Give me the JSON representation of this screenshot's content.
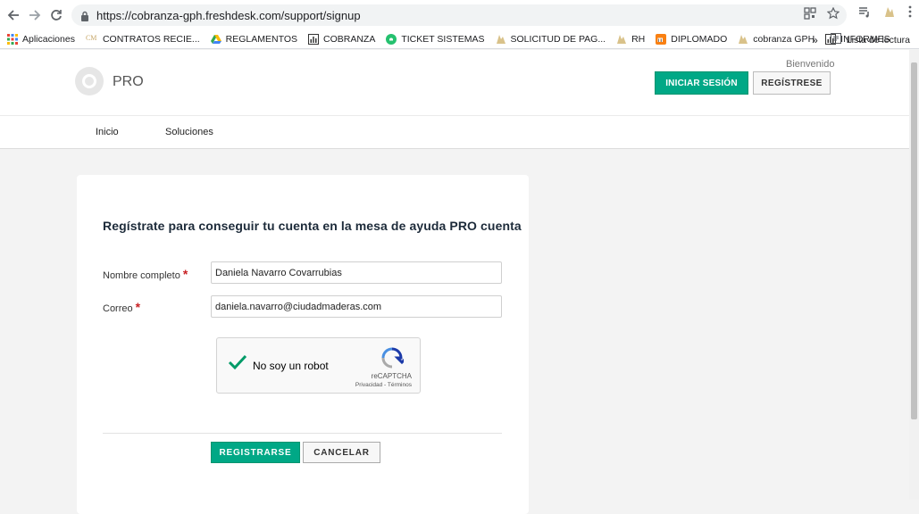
{
  "browser": {
    "url": "https://cobranza-gph.freshdesk.com/support/signup",
    "bookmarks": [
      {
        "label": "Aplicaciones",
        "icon": "apps-grid-icon"
      },
      {
        "label": "CONTRATOS RECIE...",
        "icon": "cm-icon"
      },
      {
        "label": "REGLAMENTOS",
        "icon": "drive-icon"
      },
      {
        "label": "COBRANZA",
        "icon": "chart-icon"
      },
      {
        "label": "TICKET SISTEMAS",
        "icon": "freshdesk-icon"
      },
      {
        "label": "SOLICITUD DE PAG...",
        "icon": "tree-icon"
      },
      {
        "label": "RH",
        "icon": "tree-icon"
      },
      {
        "label": "DIPLOMADO",
        "icon": "moodle-icon"
      },
      {
        "label": "cobranza GPH",
        "icon": "tree-icon"
      },
      {
        "label": "INFORMES",
        "icon": "chart-icon"
      }
    ],
    "more_label": "»",
    "reading_list_label": "Lista de lectura"
  },
  "header": {
    "brand": "PRO",
    "welcome": "Bienvenido",
    "login_label": "INICIAR SESIÓN",
    "register_label": "REGÍSTRESE"
  },
  "nav": {
    "items": [
      {
        "label": "Inicio"
      },
      {
        "label": "Soluciones"
      }
    ]
  },
  "form": {
    "title": "Regístrate para conseguir tu cuenta en la mesa de ayuda PRO cuenta",
    "name_label": "Nombre completo",
    "name_value": "Daniela Navarro Covarrubias",
    "email_label": "Correo",
    "email_value": "daniela.navarro@ciudadmaderas.com",
    "required_mark": "*",
    "captcha": {
      "text": "No soy un robot",
      "brand": "reCAPTCHA",
      "links": "Privacidad - Términos"
    },
    "submit_label": "REGISTRARSE",
    "cancel_label": "CANCELAR"
  },
  "colors": {
    "accent": "#00a886",
    "required": "#c82124"
  }
}
